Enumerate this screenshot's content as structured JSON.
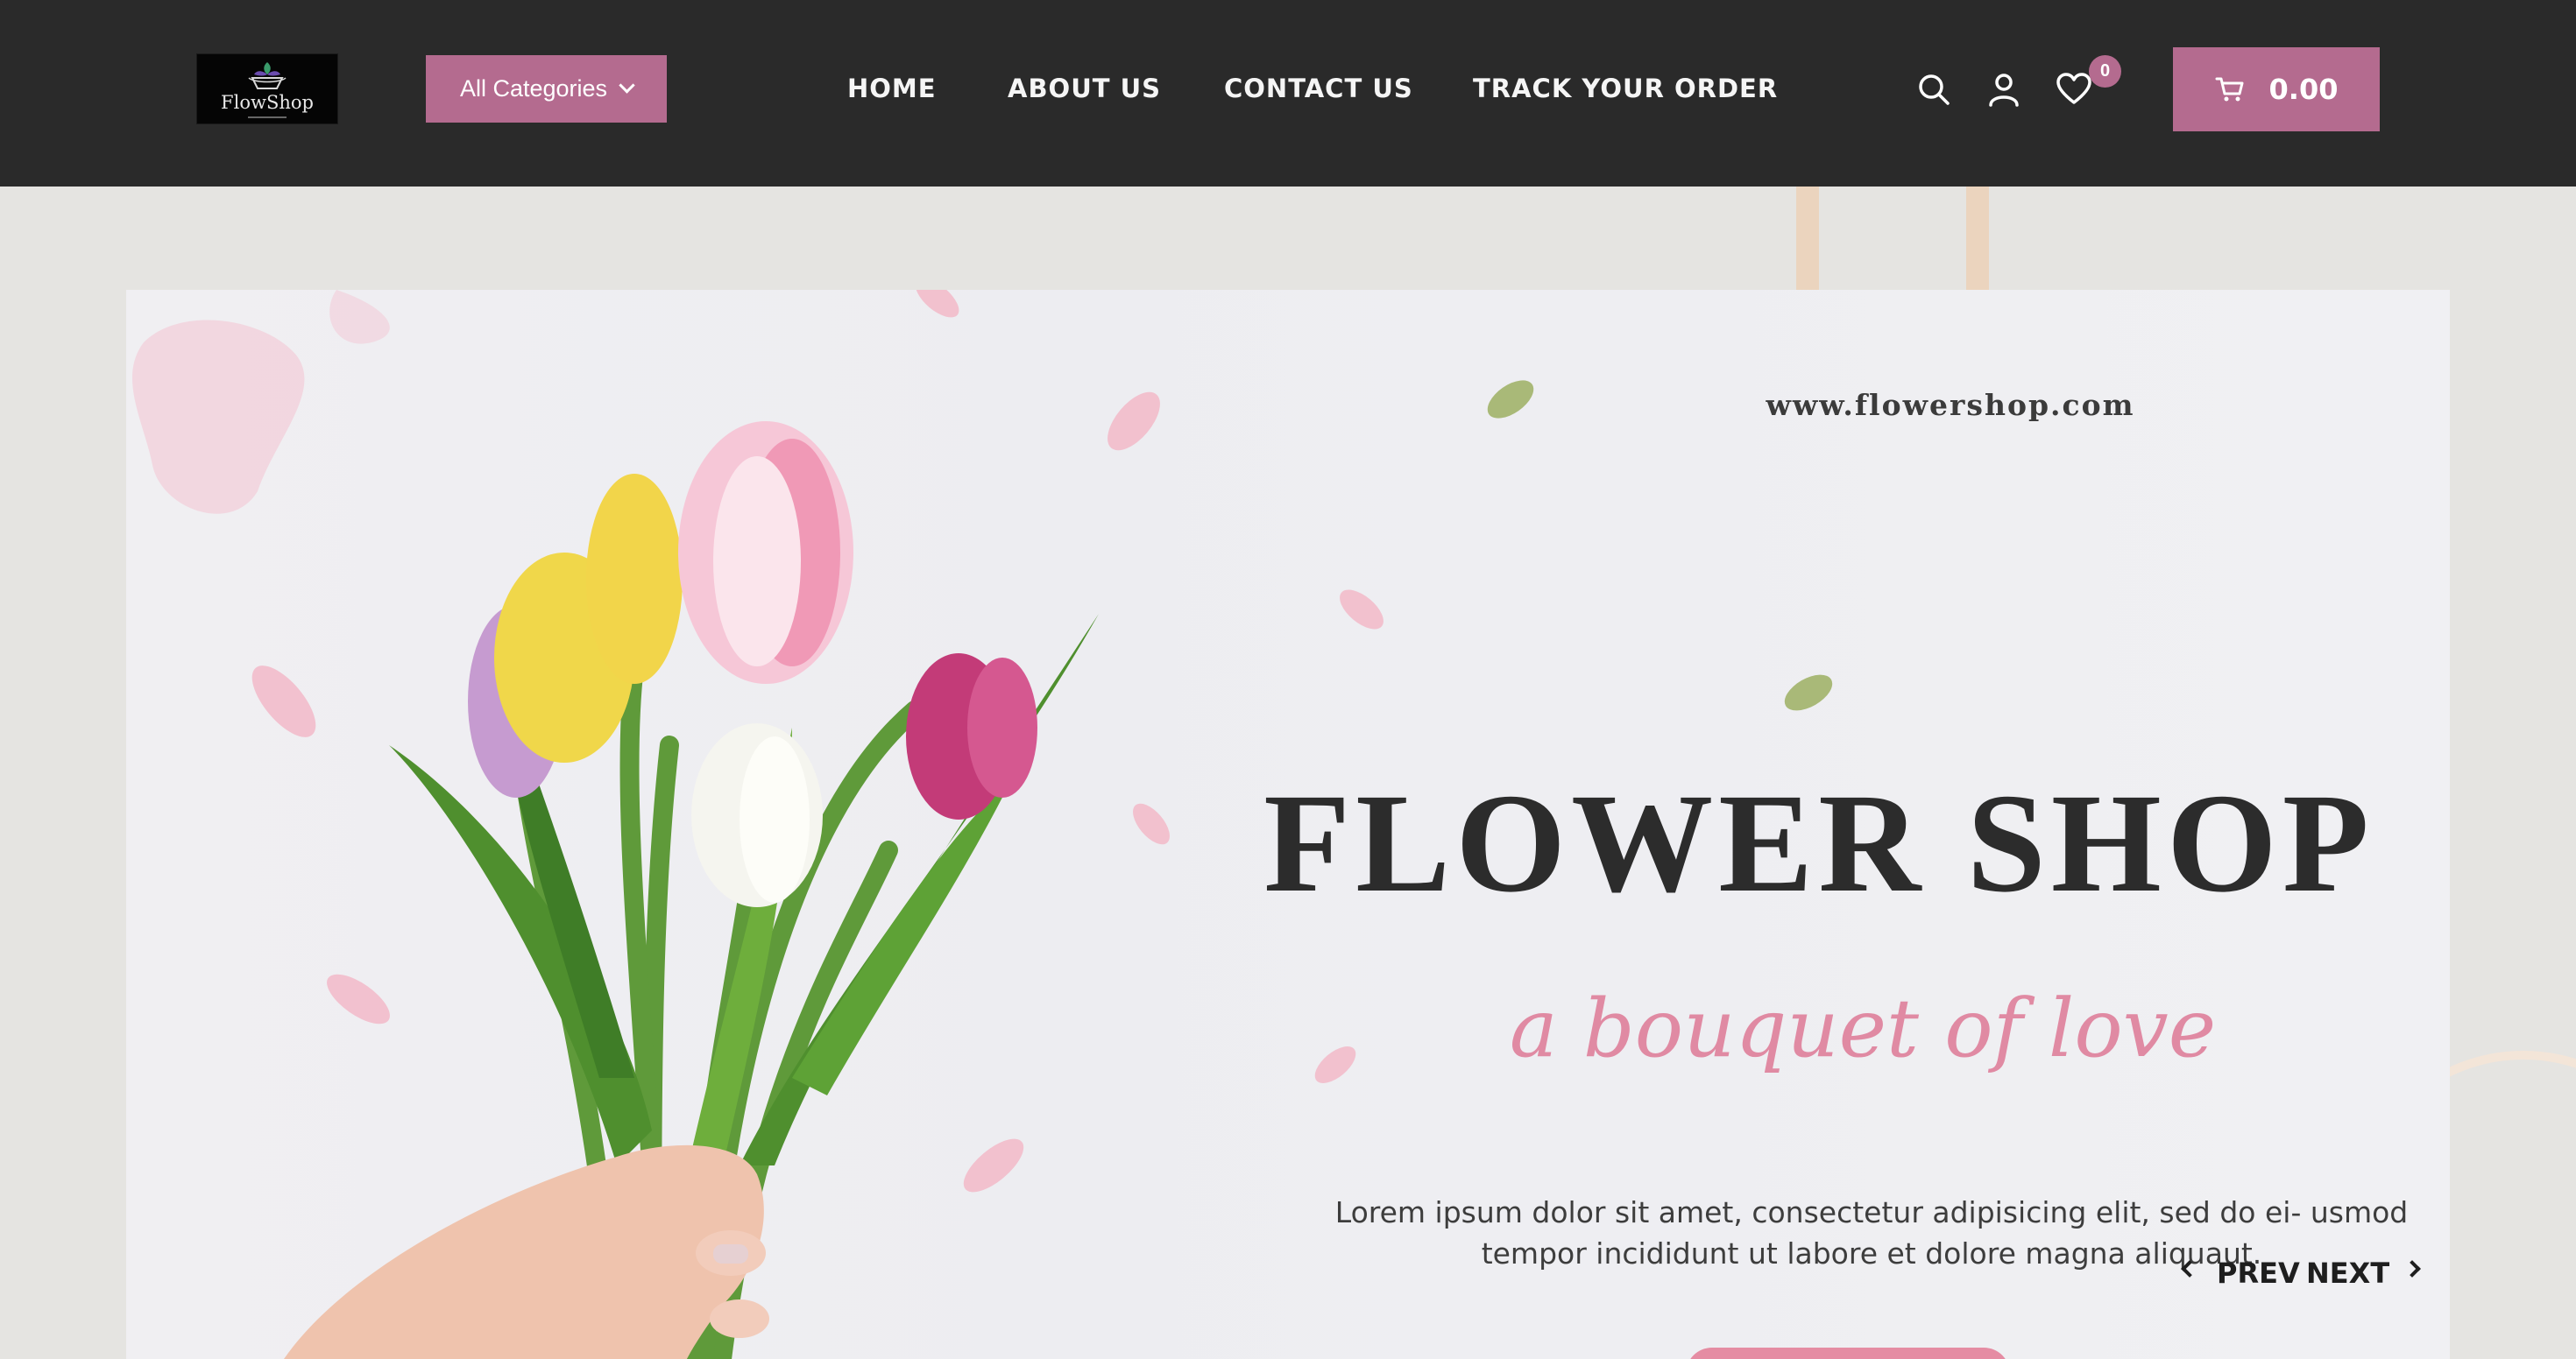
{
  "header": {
    "logo_text": "FlowShop",
    "categories_label": "All Categories",
    "nav": [
      {
        "label": "HOME"
      },
      {
        "label": "ABOUT US"
      },
      {
        "label": "CONTACT US"
      },
      {
        "label": "TRACK YOUR ORDER"
      }
    ],
    "wishlist_count": "0",
    "cart_total": "0.00",
    "icons": [
      "search-icon",
      "user-icon",
      "heart-icon",
      "cart-icon"
    ]
  },
  "banner": {
    "url": "www.flowershop.com",
    "headline": "FLOWER SHOP",
    "tagline": "a bouquet of love",
    "description": "Lorem ipsum dolor sit amet, consectetur adipisicing elit, sed do ei- usmod tempor incididunt ut labore et dolore magna aliquaut.",
    "prev_label": "PREV",
    "next_label": "NEXT"
  },
  "colors": {
    "header_bg": "#2a2a2a",
    "accent": "#b46b8f",
    "page_bg": "#e5e4e1",
    "tagline": "#e08aa3"
  }
}
